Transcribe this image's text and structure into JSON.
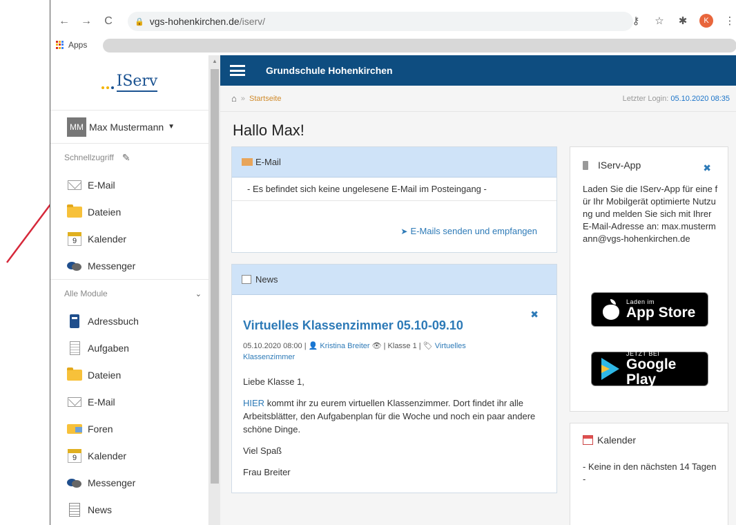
{
  "browser": {
    "url_host": "vgs-hohenkirchen.de",
    "url_path": "/iserv/",
    "bookmarks_apps_label": "Apps",
    "profile_initial": "K"
  },
  "sidebar": {
    "logo_text": "IServ",
    "user": {
      "initials": "MM",
      "name": "Max Mustermann"
    },
    "quick_label": "Schnellzugriff",
    "quick_items": [
      {
        "label": "E-Mail",
        "icon": "mail-icon"
      },
      {
        "label": "Dateien",
        "icon": "folder-icon"
      },
      {
        "label": "Kalender",
        "icon": "calendar-icon",
        "day": "9"
      },
      {
        "label": "Messenger",
        "icon": "messenger-icon"
      }
    ],
    "modules_label": "Alle Module",
    "module_items": [
      {
        "label": "Adressbuch",
        "icon": "addressbook-icon"
      },
      {
        "label": "Aufgaben",
        "icon": "tasks-icon"
      },
      {
        "label": "Dateien",
        "icon": "folder-icon"
      },
      {
        "label": "E-Mail",
        "icon": "mail-icon"
      },
      {
        "label": "Foren",
        "icon": "forum-icon"
      },
      {
        "label": "Kalender",
        "icon": "calendar-icon",
        "day": "9"
      },
      {
        "label": "Messenger",
        "icon": "messenger-icon"
      },
      {
        "label": "News",
        "icon": "news-icon"
      }
    ]
  },
  "header": {
    "school_name": "Grundschule Hohenkirchen",
    "breadcrumb": "Startseite",
    "last_login_label": "Letzter Login:",
    "last_login_value": "05.10.2020 08:35"
  },
  "main": {
    "greeting": "Hallo Max!",
    "email_panel": {
      "title": "E-Mail",
      "empty_text": "- Es befindet sich keine ungelesene E-Mail im Posteingang -",
      "link": "E-Mails senden und empfangen"
    },
    "news_panel": {
      "title": "News",
      "article_title": "Virtuelles Klassenzimmer 05.10-09.10",
      "meta_date": "05.10.2020 08:00 |",
      "meta_author": "Kristina Breiter",
      "meta_group": "| Klasse 1 |",
      "meta_tag": "Virtuelles Klassenzimmer",
      "greeting": "Liebe Klasse 1,",
      "link_word": "HIER",
      "body": "kommt ihr zu eurem virtuellen Klassenzimmer. Dort findet ihr alle Arbeitsblätter, den Aufgabenplan für die Woche und noch ein paar andere schöne Dinge.",
      "closing": "Viel Spaß",
      "signature": "Frau Breiter"
    }
  },
  "right": {
    "app_panel": {
      "title": "IServ-App",
      "text": "Laden Sie die IServ-App für eine für Ihr Mobilgerät optimierte Nutzung und melden Sie sich mit Ihrer E-Mail-Adresse an: max.mustermann@vgs-hohenkirchen.de",
      "appstore_small": "Laden im",
      "appstore_big": "App Store",
      "play_small": "JETZT BEI",
      "play_big": "Google Play"
    },
    "calendar_panel": {
      "title": "Kalender",
      "empty_text": "- Keine in den nächsten 14 Tagen -"
    }
  },
  "colors": {
    "header_blue": "#0e4d80",
    "panel_head": "#cfe3f8",
    "link_blue": "#2d7ab7",
    "annotation_arrow": "#d6283a"
  }
}
